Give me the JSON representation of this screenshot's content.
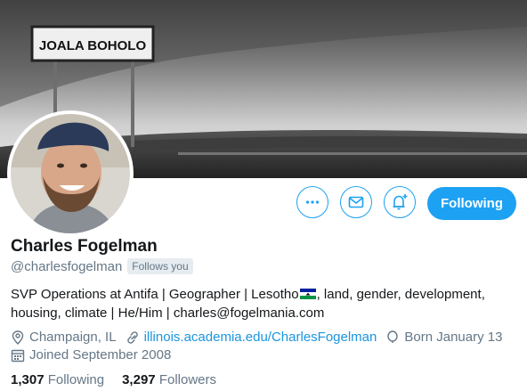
{
  "banner": {
    "sign_text": "JOALA BOHOLO"
  },
  "actions": {
    "more_icon": "more-dots-icon",
    "message_icon": "envelope-icon",
    "notify_icon": "bell-plus-icon",
    "following_label": "Following",
    "accent": "#1da1f2"
  },
  "profile": {
    "name": "Charles Fogelman",
    "handle": "@charlesfogelman",
    "follows_you": "Follows you",
    "bio_part1": "SVP Operations at Antifa | Geographer | Lesotho",
    "bio_part2": ", land, gender, development, housing, climate | He/Him | charles@fogelmania.com",
    "location": "Champaign, IL",
    "website": "illinois.academia.edu/CharlesFogelman",
    "birthday": "Born January 13",
    "joined": "Joined September 2008"
  },
  "stats": {
    "following_count": "1,307",
    "following_label": "Following",
    "followers_count": "3,297",
    "followers_label": "Followers"
  }
}
